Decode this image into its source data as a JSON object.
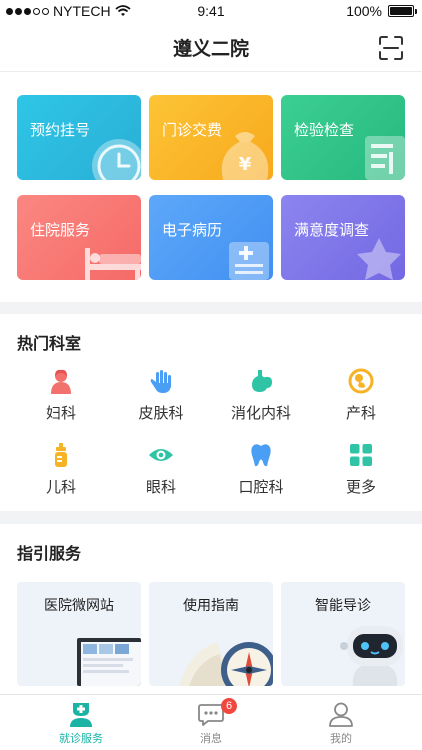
{
  "status_bar": {
    "carrier": "NYTECH",
    "time": "9:41",
    "battery": "100%"
  },
  "header": {
    "title": "遵义二院"
  },
  "main_services": [
    {
      "label": "预约挂号",
      "icon": "clock-icon"
    },
    {
      "label": "门诊交费",
      "icon": "money-bag-icon"
    },
    {
      "label": "检验检查",
      "icon": "report-icon"
    },
    {
      "label": "住院服务",
      "icon": "hospital-bed-icon"
    },
    {
      "label": "电子病历",
      "icon": "medical-record-icon"
    },
    {
      "label": "满意度调查",
      "icon": "star-icon"
    }
  ],
  "departments": {
    "title": "热门科室",
    "items": [
      {
        "label": "妇科",
        "icon": "woman-icon",
        "color": "#f2716c"
      },
      {
        "label": "皮肤科",
        "icon": "hand-icon",
        "color": "#4a9ff5"
      },
      {
        "label": "消化内科",
        "icon": "stomach-icon",
        "color": "#2ec4a5"
      },
      {
        "label": "产科",
        "icon": "fetus-icon",
        "color": "#f5b325"
      },
      {
        "label": "儿科",
        "icon": "baby-bottle-icon",
        "color": "#f5b325"
      },
      {
        "label": "眼科",
        "icon": "eye-icon",
        "color": "#2ec4a5"
      },
      {
        "label": "口腔科",
        "icon": "tooth-icon",
        "color": "#4a9ff5"
      },
      {
        "label": "更多",
        "icon": "grid-icon",
        "color": "#2ec4a5"
      }
    ]
  },
  "guidance": {
    "title": "指引服务",
    "items": [
      {
        "label": "医院微网站",
        "icon": "laptop-icon"
      },
      {
        "label": "使用指南",
        "icon": "compass-icon"
      },
      {
        "label": "智能导诊",
        "icon": "robot-icon"
      }
    ]
  },
  "tab_bar": [
    {
      "label": "就诊服务",
      "icon": "doctor-icon",
      "active": true
    },
    {
      "label": "消息",
      "icon": "message-icon",
      "badge": "6"
    },
    {
      "label": "我的",
      "icon": "person-icon"
    }
  ]
}
